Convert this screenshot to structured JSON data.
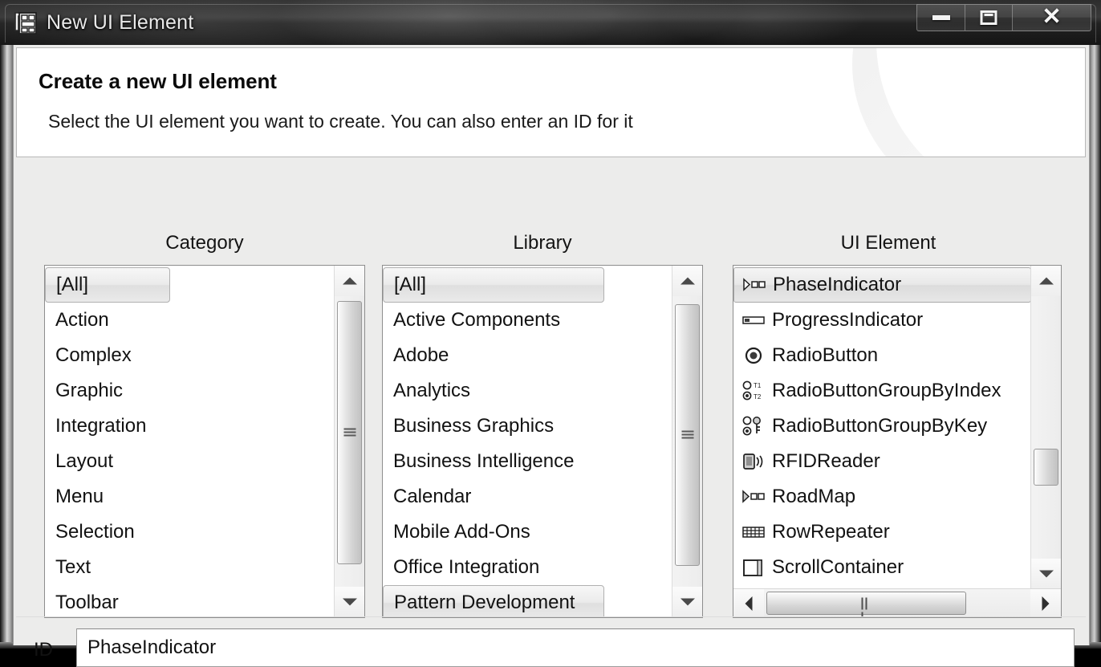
{
  "window": {
    "title": "New UI Element",
    "icon": "ui-element-icon",
    "buttons": {
      "minimize": "minimize",
      "maximize": "maximize",
      "close": "close"
    }
  },
  "header": {
    "title": "Create a new UI element",
    "subtitle": "Select the UI element you want to create. You can also enter an ID for it"
  },
  "columns": {
    "category": {
      "label": "Category",
      "items": [
        {
          "label": "[All]",
          "selected": true
        },
        {
          "label": "Action",
          "selected": false
        },
        {
          "label": "Complex",
          "selected": false
        },
        {
          "label": "Graphic",
          "selected": false
        },
        {
          "label": "Integration",
          "selected": false
        },
        {
          "label": "Layout",
          "selected": false
        },
        {
          "label": "Menu",
          "selected": false
        },
        {
          "label": "Selection",
          "selected": false
        },
        {
          "label": "Text",
          "selected": false
        },
        {
          "label": "Toolbar",
          "selected": false
        }
      ]
    },
    "library": {
      "label": "Library",
      "items": [
        {
          "label": "[All]",
          "selected": true
        },
        {
          "label": "Active Components",
          "selected": false
        },
        {
          "label": "Adobe",
          "selected": false
        },
        {
          "label": "Analytics",
          "selected": false
        },
        {
          "label": "Business Graphics",
          "selected": false
        },
        {
          "label": "Business Intelligence",
          "selected": false
        },
        {
          "label": "Calendar",
          "selected": false
        },
        {
          "label": "Mobile Add-Ons",
          "selected": false
        },
        {
          "label": "Office Integration",
          "selected": false
        },
        {
          "label": "Pattern Development",
          "selected": true
        }
      ]
    },
    "ui_element": {
      "label": "UI Element",
      "items": [
        {
          "label": "PhaseIndicator",
          "icon": "phase-indicator-icon",
          "selected": true
        },
        {
          "label": "ProgressIndicator",
          "icon": "progress-indicator-icon",
          "selected": false
        },
        {
          "label": "RadioButton",
          "icon": "radio-button-icon",
          "selected": false
        },
        {
          "label": "RadioButtonGroupByIndex",
          "icon": "radio-group-index-icon",
          "selected": false
        },
        {
          "label": "RadioButtonGroupByKey",
          "icon": "radio-group-key-icon",
          "selected": false
        },
        {
          "label": "RFIDReader",
          "icon": "rfid-reader-icon",
          "selected": false
        },
        {
          "label": "RoadMap",
          "icon": "roadmap-icon",
          "selected": false
        },
        {
          "label": "RowRepeater",
          "icon": "row-repeater-icon",
          "selected": false
        },
        {
          "label": "ScrollContainer",
          "icon": "scroll-container-icon",
          "selected": false
        }
      ]
    }
  },
  "id_field": {
    "label": "ID",
    "value": "PhaseIndicator"
  },
  "colors": {
    "window_bg": "#ececeb",
    "panel_bg": "#ffffff",
    "text": "#121212",
    "border": "#8d8d8d",
    "selected_bg": "#e4e4e4"
  }
}
